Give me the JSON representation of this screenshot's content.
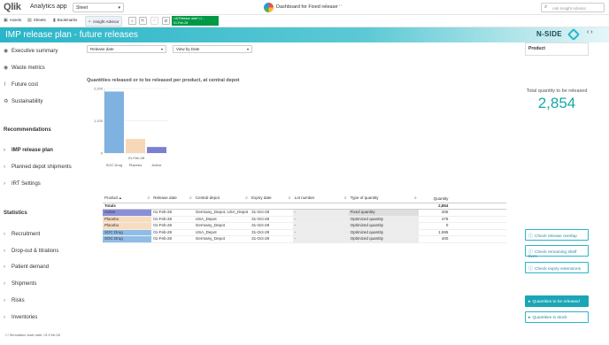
{
  "app": {
    "logo": "Qlik",
    "name": "Analytics app",
    "sheet_select": "Sheet",
    "dashboard_title": "Dashboard for Fixed release",
    "dashboard_badge": "N-SIDE",
    "search_placeholder": "Ask Insight Advisor"
  },
  "toolbar": {
    "assets": "Assets",
    "sheets": "Sheets",
    "bookmarks": "Bookmarks",
    "insight_advisor": "Insight Advisor",
    "selection_chip_title": "=if(\"Release date\"=1...",
    "selection_chip_value": "01-Feb-28"
  },
  "header": {
    "title": "IMP release plan - future releases",
    "brand": "N-SIDE",
    "accent_color": "#2ab5c8"
  },
  "sidebar": {
    "items_top": [
      {
        "label": "Executive summary",
        "icon": "eye-icon"
      },
      {
        "label": "Waste metrics",
        "icon": "eye-icon"
      },
      {
        "label": "Future cost",
        "icon": "chart-icon"
      },
      {
        "label": "Sustainability",
        "icon": "recycle-icon"
      }
    ],
    "recommendations_header": "Recommendations",
    "recommendations": [
      {
        "label": "IMP release plan",
        "active": true
      },
      {
        "label": "Planned depot shipments"
      },
      {
        "label": "IRT Settings"
      }
    ],
    "statistics_header": "Statistics",
    "statistics": [
      {
        "label": "Recruitment"
      },
      {
        "label": "Drop-out & titrations"
      },
      {
        "label": "Patient demand"
      },
      {
        "label": "Shipments"
      },
      {
        "label": "Risks"
      },
      {
        "label": "Inventories"
      }
    ]
  },
  "filters": {
    "release_date": "Release date",
    "view_by": "View by Date",
    "product_panel": "Product"
  },
  "chart_data": {
    "type": "bar",
    "title": "Quantities released or to be released per product, at central depot",
    "categories": [
      "SOC Drug",
      "Placebo",
      "Active"
    ],
    "group_label": "01-Feb-28",
    "values": [
      2095,
      479,
      206
    ],
    "colors": [
      "#7fb2e0",
      "#f6d7b8",
      "#7b7fcf"
    ],
    "ylim": [
      0,
      2200
    ],
    "yticks": [
      {
        "v": 0,
        "label": "0"
      },
      {
        "v": 1100,
        "label": "1,100"
      },
      {
        "v": 2200,
        "label": "2,200"
      }
    ]
  },
  "kpi": {
    "label": "Total quantity to be released",
    "value": "2,854"
  },
  "table": {
    "headers": [
      "Product",
      "Release date",
      "Central depot",
      "Expiry date",
      "Lot number",
      "Type of quantity",
      "Quantity"
    ],
    "totals_label": "Totals",
    "totals_value": "2,854",
    "rows": [
      {
        "product": "Active",
        "release": "01-Feb-28",
        "depot": "Germany_Depot, USA_Depot",
        "expiry": "31-Oct-28",
        "lot": "-",
        "type": "Fixed quantity",
        "qty": "206",
        "color": "#8a8fd9"
      },
      {
        "product": "Placebo",
        "release": "01-Feb-28",
        "depot": "USA_Depot",
        "expiry": "31-Oct-28",
        "lot": "-",
        "type": "Optimized quantity",
        "qty": "479",
        "color": "#f8dcc0"
      },
      {
        "product": "Placebo",
        "release": "01-Feb-28",
        "depot": "Germany_Depot",
        "expiry": "31-Oct-28",
        "lot": "-",
        "type": "Optimized quantity",
        "qty": "0",
        "color": "#f8dcc0"
      },
      {
        "product": "SOC Drug",
        "release": "01-Feb-28",
        "depot": "USA_Depot",
        "expiry": "31-Oct-28",
        "lot": "-",
        "type": "Optimized quantity",
        "qty": "1,695",
        "color": "#8fbde6"
      },
      {
        "product": "SOC Drug",
        "release": "01-Feb-28",
        "depot": "Germany_Depot",
        "expiry": "31-Oct-28",
        "lot": "-",
        "type": "Optimized quantity",
        "qty": "400",
        "color": "#8fbde6"
      }
    ]
  },
  "right_buttons": {
    "check_release_overlap": "Check release overlap",
    "check_remaining_shelf_lives": "Check remaining shelf lives",
    "check_expiry_extensions": "Check expiry extensions",
    "quantities_to_be_released": "Quantities to be released",
    "quantities_in_stock": "Quantities in stock"
  },
  "footer": {
    "note": "Simulation start date: 01-Feb-28"
  }
}
